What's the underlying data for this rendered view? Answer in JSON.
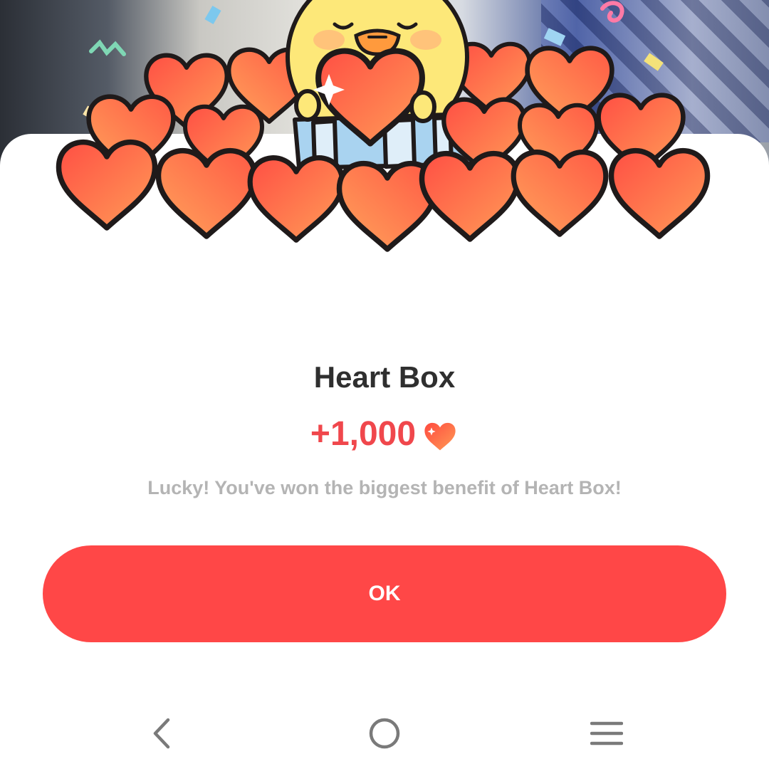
{
  "dialog": {
    "title": "Heart Box",
    "amount": "+1,000",
    "message": "Lucky! You've won the biggest benefit of Heart Box!",
    "ok_label": "OK"
  },
  "icons": {
    "amount": "heart-icon",
    "nav_back": "chevron-left-icon",
    "nav_home": "circle-icon",
    "nav_recents": "menu-lines-icon"
  },
  "colors": {
    "accent": "#ff4747",
    "amount_text": "#f0474c",
    "title_text": "#2f2f2f",
    "message_text": "#b4b4b4",
    "heart_light": "#ff9a55",
    "heart_dark": "#ff4a3f"
  }
}
